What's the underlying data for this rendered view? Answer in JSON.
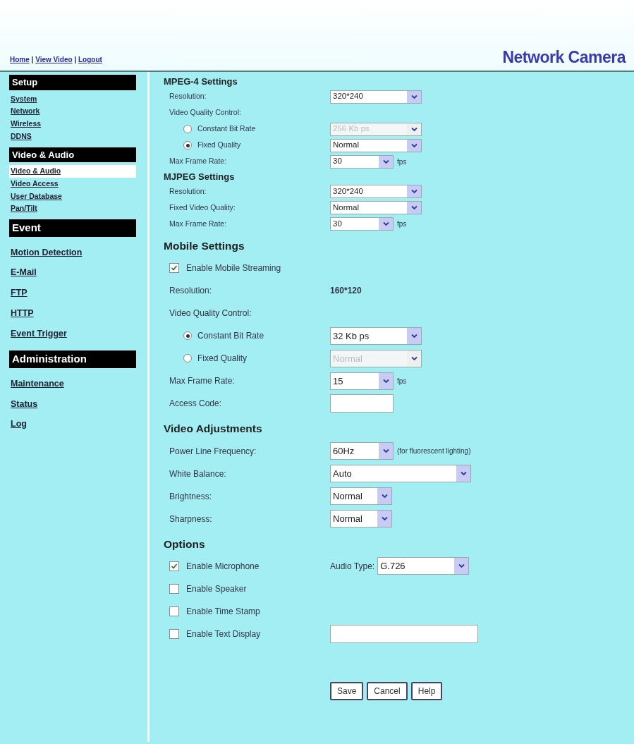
{
  "header": {
    "links": [
      "Home",
      "View Video",
      "Logout"
    ],
    "separator": "|",
    "title": "Network Camera"
  },
  "sidebar": [
    {
      "title": "Setup",
      "kind": "compact",
      "items": [
        {
          "label": "System",
          "selected": false
        },
        {
          "label": "Network",
          "selected": false
        },
        {
          "label": "Wireless",
          "selected": false
        },
        {
          "label": "DDNS",
          "selected": false
        }
      ]
    },
    {
      "title": "Video & Audio",
      "kind": "compact",
      "items": [
        {
          "label": "Video & Audio",
          "selected": true
        },
        {
          "label": "Video Access",
          "selected": false
        },
        {
          "label": "User Database",
          "selected": false
        },
        {
          "label": "Pan/Tilt",
          "selected": false
        }
      ]
    },
    {
      "title": "Event",
      "kind": "large",
      "items": [
        {
          "label": "Motion Detection",
          "selected": false
        },
        {
          "label": "E-Mail",
          "selected": false
        },
        {
          "label": "FTP",
          "selected": false
        },
        {
          "label": "HTTP",
          "selected": false
        },
        {
          "label": "Event Trigger",
          "selected": false
        }
      ]
    },
    {
      "title": "Administration",
      "kind": "large",
      "items": [
        {
          "label": "Maintenance",
          "selected": false
        },
        {
          "label": "Status",
          "selected": false
        },
        {
          "label": "Log",
          "selected": false
        }
      ]
    }
  ],
  "sections": [
    {
      "title": "MPEG-4 Settings",
      "kind": "compact",
      "rows": [
        {
          "kind": "select",
          "label": "Resolution:",
          "value": "320*240"
        },
        {
          "kind": "label",
          "label": "Video Quality Control:"
        },
        {
          "kind": "radio",
          "label": "Constant Bit Rate",
          "selected": false,
          "value": "256 Kb ps",
          "disabled": true
        },
        {
          "kind": "radio",
          "label": "Fixed Quality",
          "selected": true,
          "value": "Normal",
          "disabled": false
        },
        {
          "kind": "short-select",
          "label": "Max Frame Rate:",
          "value": "30",
          "unit": "fps"
        }
      ]
    },
    {
      "title": "MJPEG Settings",
      "kind": "compact",
      "rows": [
        {
          "kind": "select",
          "label": "Resolution:",
          "value": "320*240"
        },
        {
          "kind": "select",
          "label": "Fixed Video Quality:",
          "value": "Normal"
        },
        {
          "kind": "short-select",
          "label": "Max Frame Rate:",
          "value": "30",
          "unit": "fps"
        }
      ]
    },
    {
      "title": "Mobile Settings",
      "kind": "large",
      "rows": [
        {
          "kind": "checkbox",
          "label": "Enable Mobile Streaming",
          "checked": true
        },
        {
          "kind": "text",
          "label": "Resolution:",
          "value": "160*120"
        },
        {
          "kind": "label",
          "label": "Video Quality Control:"
        },
        {
          "kind": "radio",
          "label": "Constant Bit Rate",
          "selected": true,
          "value": "32 Kb ps",
          "disabled": false
        },
        {
          "kind": "radio",
          "label": "Fixed Quality",
          "selected": false,
          "value": "Normal",
          "disabled": true
        },
        {
          "kind": "short-select",
          "label": "Max Frame Rate:",
          "value": "15",
          "unit": "fps"
        },
        {
          "kind": "input",
          "label": "Access Code:"
        }
      ]
    },
    {
      "title": "Video Adjustments",
      "kind": "large",
      "rows": [
        {
          "kind": "short-select",
          "label": "Power Line Frequency:",
          "value": "60Hz",
          "note": "(for fluorescent lighting)"
        },
        {
          "kind": "wide-select",
          "label": "White Balance:",
          "value": "Auto"
        },
        {
          "kind": "tiny-select",
          "label": "Brightness:",
          "value": "Normal"
        },
        {
          "kind": "tiny-select",
          "label": "Sharpness:",
          "value": "Normal"
        }
      ]
    },
    {
      "title": "Options",
      "kind": "large",
      "rows": [
        {
          "kind": "checkbox",
          "label": "Enable Microphone",
          "checked": true,
          "extra_label": "Audio Type:",
          "value": "G.726"
        },
        {
          "kind": "checkbox",
          "label": "Enable Speaker",
          "checked": false
        },
        {
          "kind": "checkbox",
          "label": "Enable Time Stamp",
          "checked": false
        },
        {
          "kind": "checkbox-input",
          "label": "Enable Text Display",
          "checked": false
        }
      ]
    }
  ],
  "buttons": [
    "Save",
    "Cancel",
    "Help"
  ]
}
